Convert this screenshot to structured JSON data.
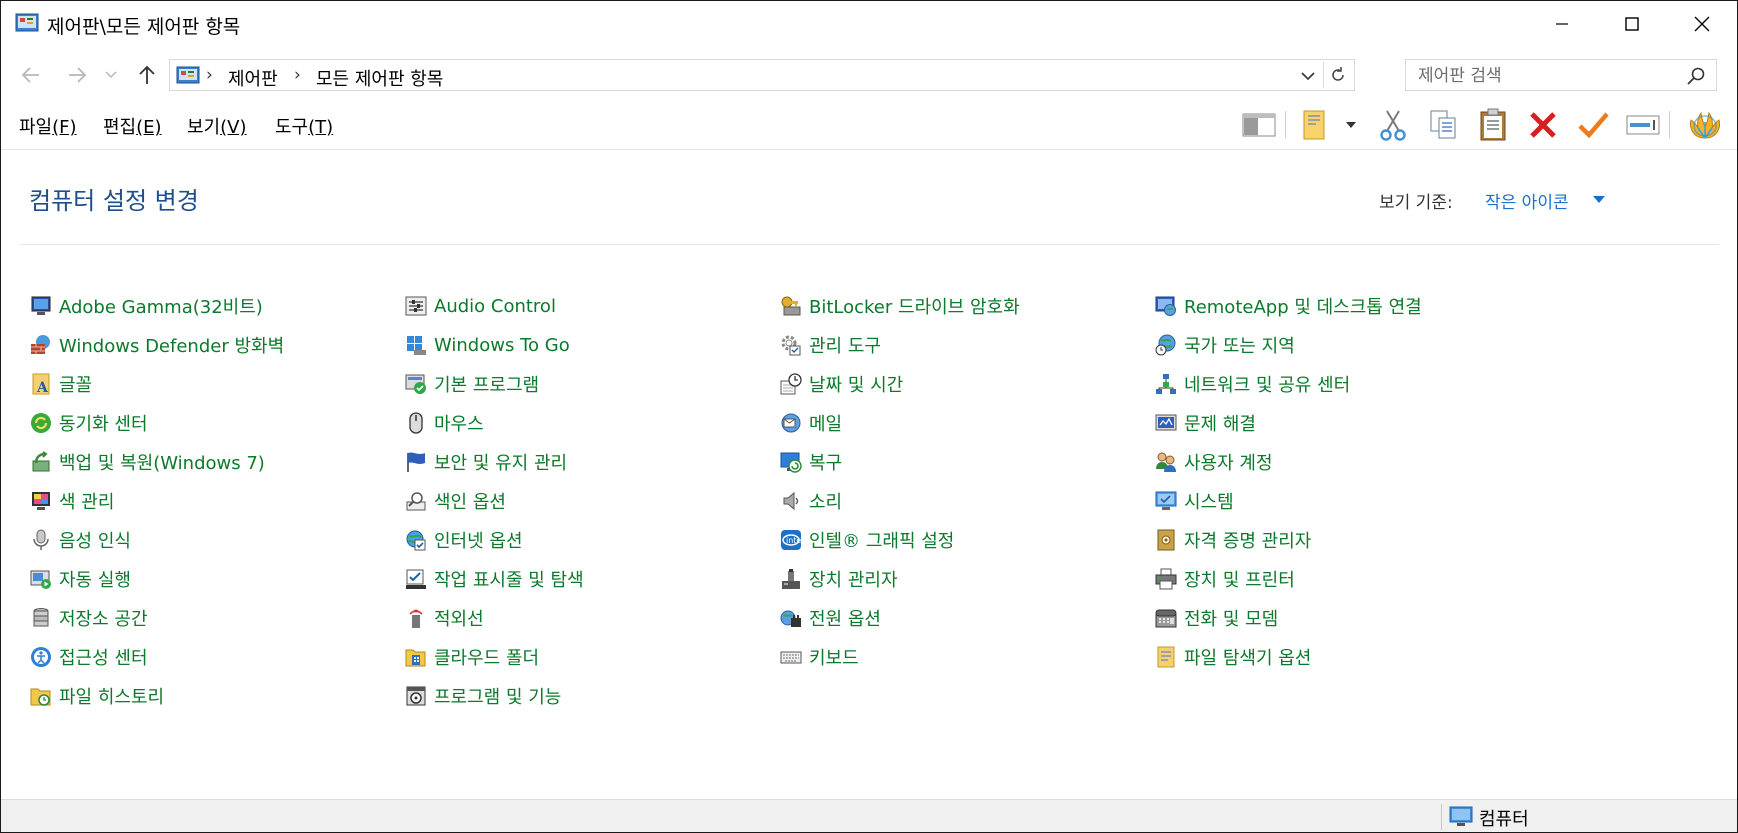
{
  "window": {
    "title": "제어판\\모든 제어판 항목",
    "minimize_icon": "minimize-icon",
    "maximize_icon": "maximize-icon",
    "close_icon": "close-icon"
  },
  "address": {
    "crumbs": [
      "제어판",
      "모든 제어판 항목"
    ],
    "search_placeholder": "제어판 검색"
  },
  "menu": {
    "items": [
      {
        "label": "파일",
        "key": "(F)"
      },
      {
        "label": "편집",
        "key": "(E)"
      },
      {
        "label": "보기",
        "key": "(V)"
      },
      {
        "label": "도구",
        "key": "(T)"
      }
    ]
  },
  "toolbar": {
    "icons": [
      "preview-pane-icon",
      "new-folder-icon",
      "cut-icon",
      "copy-icon",
      "paste-icon",
      "delete-icon",
      "check-icon",
      "rename-icon",
      "shell-icon"
    ]
  },
  "header": {
    "title": "컴퓨터 설정 변경",
    "view_by_label": "보기 기준:",
    "view_by_value": "작은 아이콘"
  },
  "items": {
    "col1": [
      {
        "label": "Adobe Gamma(32비트)",
        "icon": "monitor-icon"
      },
      {
        "label": "Windows Defender 방화벽",
        "icon": "firewall-icon"
      },
      {
        "label": "글꼴",
        "icon": "font-icon"
      },
      {
        "label": "동기화 센터",
        "icon": "sync-icon"
      },
      {
        "label": "백업 및 복원(Windows 7)",
        "icon": "backup-icon"
      },
      {
        "label": "색 관리",
        "icon": "color-icon"
      },
      {
        "label": "음성 인식",
        "icon": "microphone-icon"
      },
      {
        "label": "자동 실행",
        "icon": "autoplay-icon"
      },
      {
        "label": "저장소 공간",
        "icon": "storage-icon"
      },
      {
        "label": "접근성 센터",
        "icon": "accessibility-icon"
      },
      {
        "label": "파일 히스토리",
        "icon": "file-history-icon"
      }
    ],
    "col2": [
      {
        "label": "Audio Control",
        "icon": "audio-control-icon"
      },
      {
        "label": "Windows To Go",
        "icon": "windows-to-go-icon"
      },
      {
        "label": "기본 프로그램",
        "icon": "default-programs-icon"
      },
      {
        "label": "마우스",
        "icon": "mouse-icon"
      },
      {
        "label": "보안 및 유지 관리",
        "icon": "flag-icon"
      },
      {
        "label": "색인 옵션",
        "icon": "indexing-icon"
      },
      {
        "label": "인터넷 옵션",
        "icon": "internet-icon"
      },
      {
        "label": "작업 표시줄 및 탐색",
        "icon": "taskbar-icon"
      },
      {
        "label": "적외선",
        "icon": "infrared-icon"
      },
      {
        "label": "클라우드 폴더",
        "icon": "cloud-folder-icon"
      },
      {
        "label": "프로그램 및 기능",
        "icon": "programs-icon"
      }
    ],
    "col3": [
      {
        "label": "BitLocker 드라이브 암호화",
        "icon": "bitlocker-icon"
      },
      {
        "label": "관리 도구",
        "icon": "admin-tools-icon"
      },
      {
        "label": "날짜 및 시간",
        "icon": "clock-icon"
      },
      {
        "label": "메일",
        "icon": "mail-icon"
      },
      {
        "label": "복구",
        "icon": "recovery-icon"
      },
      {
        "label": "소리",
        "icon": "speaker-icon"
      },
      {
        "label": "인텔® 그래픽 설정",
        "icon": "intel-graphics-icon"
      },
      {
        "label": "장치 관리자",
        "icon": "device-manager-icon"
      },
      {
        "label": "전원 옵션",
        "icon": "power-icon"
      },
      {
        "label": "키보드",
        "icon": "keyboard-icon"
      }
    ],
    "col4": [
      {
        "label": "RemoteApp 및 데스크톱 연결",
        "icon": "remoteapp-icon"
      },
      {
        "label": "국가 또는 지역",
        "icon": "region-icon"
      },
      {
        "label": "네트워크 및 공유 센터",
        "icon": "network-icon"
      },
      {
        "label": "문제 해결",
        "icon": "troubleshoot-icon"
      },
      {
        "label": "사용자 계정",
        "icon": "users-icon"
      },
      {
        "label": "시스템",
        "icon": "system-icon"
      },
      {
        "label": "자격 증명 관리자",
        "icon": "credential-icon"
      },
      {
        "label": "장치 및 프린터",
        "icon": "printer-icon"
      },
      {
        "label": "전화 및 모뎀",
        "icon": "phone-icon"
      },
      {
        "label": "파일 탐색기 옵션",
        "icon": "folder-options-icon"
      }
    ]
  },
  "status": {
    "text": "컴퓨터"
  }
}
